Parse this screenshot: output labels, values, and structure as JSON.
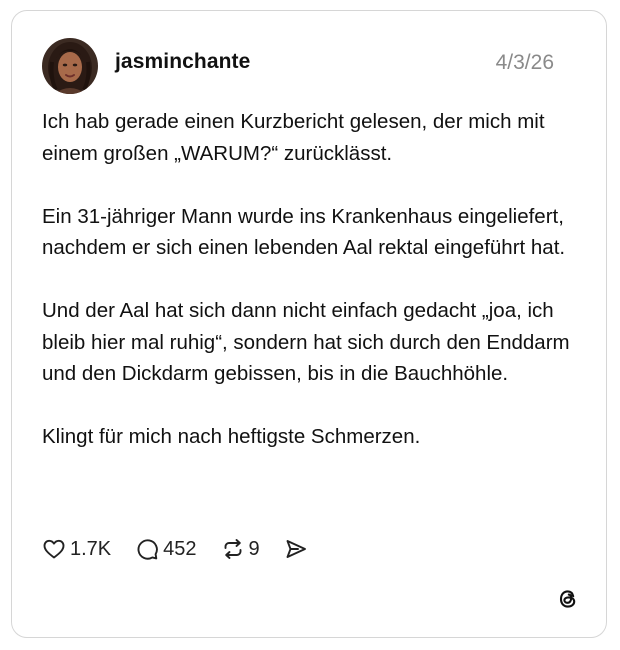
{
  "post": {
    "author": {
      "username": "jasminchante",
      "avatar_icon": "profile-photo"
    },
    "date": "4/3/26",
    "paragraphs": [
      "Ich hab gerade einen Kurzbericht gelesen, der mich mit einem großen „WARUM?“ zurücklässt.",
      "Ein 31-jähriger Mann wurde ins Krankenhaus eingeliefert, nachdem er sich einen lebenden Aal rektal eingeführt hat.",
      "Und der Aal hat sich dann nicht einfach gedacht „joa, ich bleib hier mal ruhig“, sondern hat sich durch den Enddarm und den Dickdarm gebissen, bis in die Bauchhöhle.",
      "Klingt für mich nach heftigste Schmerzen."
    ],
    "stats": {
      "likes": "1.7K",
      "replies": "452",
      "reposts": "9"
    },
    "icons": {
      "like": "heart-icon",
      "reply": "comment-icon",
      "repost": "repost-icon",
      "share": "send-icon",
      "brand": "threads-logo"
    }
  }
}
